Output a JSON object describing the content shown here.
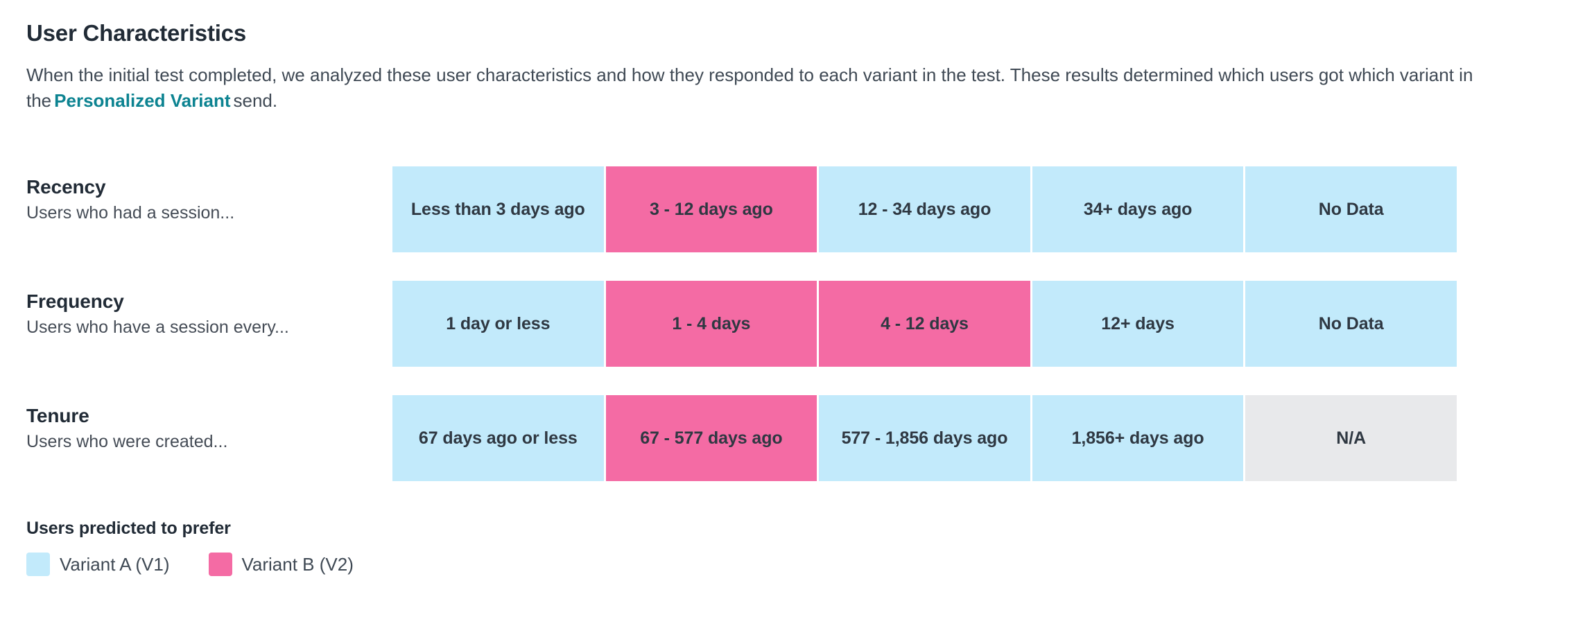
{
  "header": {
    "title": "User Characteristics",
    "description_part1": "When the initial test completed, we analyzed these user characteristics and how they responded to each variant in the test. These results determined which users got which variant in the",
    "description_link": "Personalized Variant",
    "description_part2": "send."
  },
  "chart_data": {
    "type": "heatmap",
    "title": "User Characteristics",
    "legend_position": "bottom-left",
    "legend_title": "Users predicted to prefer",
    "categories": [
      "Recency",
      "Frequency",
      "Tenure"
    ],
    "row_subtitles": [
      "Users who had a session...",
      "Users who have a session every...",
      "Users who were created..."
    ],
    "series": [
      {
        "name": "Variant A (V1)",
        "color": "#c2eafb"
      },
      {
        "name": "Variant B (V2)",
        "color": "#f46ba4"
      },
      {
        "name": "N/A",
        "color": "#e8e9eb"
      }
    ],
    "rows": [
      {
        "label": "Recency",
        "sublabel": "Users who had a session...",
        "cells": [
          {
            "label": "Less than 3 days ago",
            "variant": "variant-a"
          },
          {
            "label": "3 - 12 days ago",
            "variant": "variant-b"
          },
          {
            "label": "12 - 34 days ago",
            "variant": "variant-a"
          },
          {
            "label": "34+ days ago",
            "variant": "variant-a"
          },
          {
            "label": "No Data",
            "variant": "variant-a"
          }
        ]
      },
      {
        "label": "Frequency",
        "sublabel": "Users who have a session every...",
        "cells": [
          {
            "label": "1 day or less",
            "variant": "variant-a"
          },
          {
            "label": "1 - 4 days",
            "variant": "variant-b"
          },
          {
            "label": "4 - 12 days",
            "variant": "variant-b"
          },
          {
            "label": "12+ days",
            "variant": "variant-a"
          },
          {
            "label": "No Data",
            "variant": "variant-a"
          }
        ]
      },
      {
        "label": "Tenure",
        "sublabel": "Users who were created...",
        "cells": [
          {
            "label": "67 days ago or less",
            "variant": "variant-a"
          },
          {
            "label": "67 - 577 days ago",
            "variant": "variant-b"
          },
          {
            "label": "577 - 1,856 days ago",
            "variant": "variant-a"
          },
          {
            "label": "1,856+ days ago",
            "variant": "variant-a"
          },
          {
            "label": "N/A",
            "variant": "na"
          }
        ]
      }
    ]
  },
  "legend": {
    "title": "Users predicted to prefer",
    "items": [
      {
        "label": "Variant A (V1)",
        "variant": "variant-a"
      },
      {
        "label": "Variant B (V2)",
        "variant": "variant-b"
      }
    ]
  },
  "colors": {
    "variant_a": "#c2eafb",
    "variant_b": "#f46ba4",
    "na": "#e8e9eb",
    "link_teal": "#0c8391",
    "heading": "#212b36",
    "body_text": "#3f4954"
  }
}
